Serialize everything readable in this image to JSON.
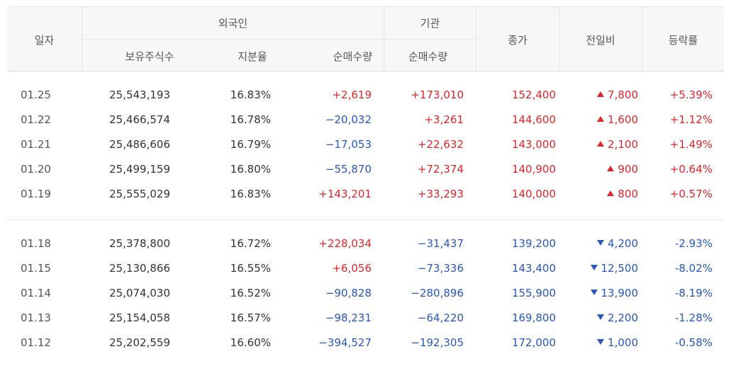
{
  "header": {
    "date": "일자",
    "foreign": "외국인",
    "institution": "기관",
    "close": "종가",
    "change": "전일비",
    "rate": "등락률",
    "foreign_holdings": "보유주식수",
    "foreign_ratio": "지분율",
    "foreign_net": "순매수량",
    "inst_net": "순매수량"
  },
  "colors": {
    "up": "#e0242b",
    "down": "#2857b8"
  },
  "groups": [
    [
      {
        "date": "01.25",
        "holdings": "25,543,193",
        "ratio": "16.83%",
        "fnet": "+2,619",
        "fnet_dir": "up",
        "inet": "+173,010",
        "inet_dir": "up",
        "close": "152,400",
        "dir": "up",
        "change": "7,800",
        "rate": "+5.39%"
      },
      {
        "date": "01.22",
        "holdings": "25,466,574",
        "ratio": "16.78%",
        "fnet": "−20,032",
        "fnet_dir": "down",
        "inet": "+3,261",
        "inet_dir": "up",
        "close": "144,600",
        "dir": "up",
        "change": "1,600",
        "rate": "+1.12%"
      },
      {
        "date": "01.21",
        "holdings": "25,486,606",
        "ratio": "16.79%",
        "fnet": "−17,053",
        "fnet_dir": "down",
        "inet": "+22,632",
        "inet_dir": "up",
        "close": "143,000",
        "dir": "up",
        "change": "2,100",
        "rate": "+1.49%"
      },
      {
        "date": "01.20",
        "holdings": "25,499,159",
        "ratio": "16.80%",
        "fnet": "−55,870",
        "fnet_dir": "down",
        "inet": "+72,374",
        "inet_dir": "up",
        "close": "140,900",
        "dir": "up",
        "change": "900",
        "rate": "+0.64%"
      },
      {
        "date": "01.19",
        "holdings": "25,555,029",
        "ratio": "16.83%",
        "fnet": "+143,201",
        "fnet_dir": "up",
        "inet": "+33,293",
        "inet_dir": "up",
        "close": "140,000",
        "dir": "up",
        "change": "800",
        "rate": "+0.57%"
      }
    ],
    [
      {
        "date": "01.18",
        "holdings": "25,378,800",
        "ratio": "16.72%",
        "fnet": "+228,034",
        "fnet_dir": "up",
        "inet": "−31,437",
        "inet_dir": "down",
        "close": "139,200",
        "dir": "down",
        "change": "4,200",
        "rate": "-2.93%"
      },
      {
        "date": "01.15",
        "holdings": "25,130,866",
        "ratio": "16.55%",
        "fnet": "+6,056",
        "fnet_dir": "up",
        "inet": "−73,336",
        "inet_dir": "down",
        "close": "143,400",
        "dir": "down",
        "change": "12,500",
        "rate": "-8.02%"
      },
      {
        "date": "01.14",
        "holdings": "25,074,030",
        "ratio": "16.52%",
        "fnet": "−90,828",
        "fnet_dir": "down",
        "inet": "−280,896",
        "inet_dir": "down",
        "close": "155,900",
        "dir": "down",
        "change": "13,900",
        "rate": "-8.19%"
      },
      {
        "date": "01.13",
        "holdings": "25,154,058",
        "ratio": "16.57%",
        "fnet": "−98,231",
        "fnet_dir": "down",
        "inet": "−64,220",
        "inet_dir": "down",
        "close": "169,800",
        "dir": "down",
        "change": "2,200",
        "rate": "-1.28%"
      },
      {
        "date": "01.12",
        "holdings": "25,202,559",
        "ratio": "16.60%",
        "fnet": "−394,527",
        "fnet_dir": "down",
        "inet": "−192,305",
        "inet_dir": "down",
        "close": "172,000",
        "dir": "down",
        "change": "1,000",
        "rate": "-0.58%"
      }
    ]
  ]
}
